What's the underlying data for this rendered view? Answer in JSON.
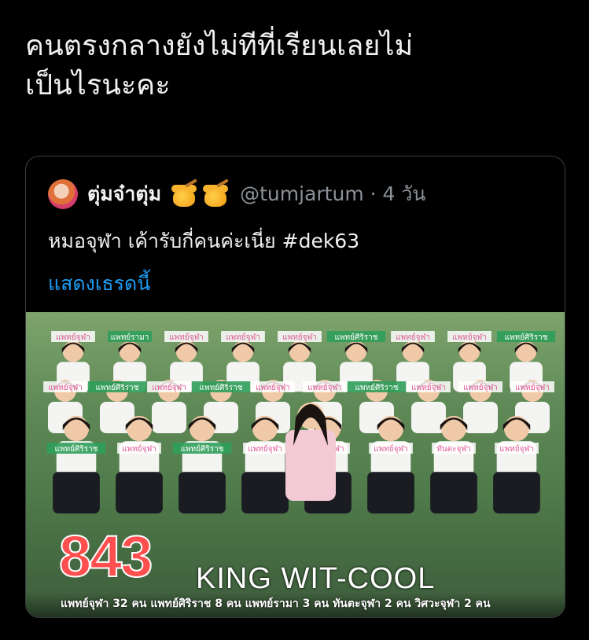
{
  "tweet": {
    "text_line1": "คนตรงกลางยังไม่ทีที่เรียนเลยไม่",
    "text_line2": "เป็นไรนะคะ"
  },
  "quote": {
    "display_name": "ตุ่มจ๋าตุ่ม",
    "emoji": [
      "honey-pot",
      "honey-pot"
    ],
    "handle_time": "@tumjartum · 4 วัน",
    "body": "หมอจุฬา เค้ารับกี่คนค่ะเนี่ย #dek63",
    "show_thread": "แสดงเธรดนี้"
  },
  "photo": {
    "number": "843",
    "subtitle": "KING WIT-COOL",
    "caption": "แพทย์จุฬา 32 คน แพทย์ศิริราช 8 คน แพทย์รามา 3 คน ทันตะจุฬา 2 คน วิศวะจุฬา 2 คน",
    "tags_row1": [
      "แพทย์จุฬา",
      "แพทย์รามา",
      "แพทย์จุฬา",
      "แพทย์จุฬา",
      "แพทย์จุฬา",
      "แพทย์ศิริราช",
      "แพทย์จุฬา",
      "แพทย์จุฬา",
      "แพทย์ศิริราช"
    ],
    "tags_row2": [
      "แพทย์จุฬา",
      "แพทย์ศิริราช",
      "แพทย์จุฬา",
      "แพทย์ศิริราช",
      "แพทย์จุฬา",
      "แพทย์จุฬา",
      "แพทย์ศิริราช",
      "แพทย์จุฬา",
      "แพทย์จุฬา",
      "แพทย์จุฬา"
    ],
    "tags_row3": [
      "แพทย์ศิริราช",
      "แพทย์จุฬา",
      "แพทย์ศิริราช",
      "แพทย์จุฬา",
      "วิศวะจุฬา",
      "แพทย์จุฬา",
      "ทันตะจุฬา",
      "แพทย์จุฬา"
    ]
  },
  "colors": {
    "link": "#1d9bf0",
    "tag_pink": "#e05a9a",
    "tag_green": "#2f9e5a",
    "number_red": "#ff4f4f"
  }
}
